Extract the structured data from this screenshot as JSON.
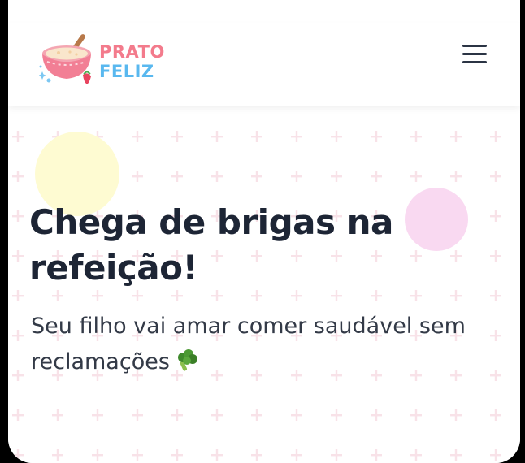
{
  "brand": {
    "line1": "PRATO",
    "line2": "FELIZ",
    "colors": {
      "line1": "#f37b8c",
      "line2": "#59b8ef"
    },
    "logo_icon": "porridge-bowl-icon"
  },
  "header": {
    "menu_icon": "hamburger-menu-icon"
  },
  "hero": {
    "headline": "Chega de brigas na refeição!",
    "subtitle": "Seu filho vai amar comer saudável sem reclamações",
    "subtitle_icon": "broccoli-icon",
    "accent_colors": {
      "yellow_blob": "#fefbd2",
      "pink_blob": "#f9d9f1",
      "pattern": "#f8e2e8",
      "text": "#1d2535"
    }
  }
}
